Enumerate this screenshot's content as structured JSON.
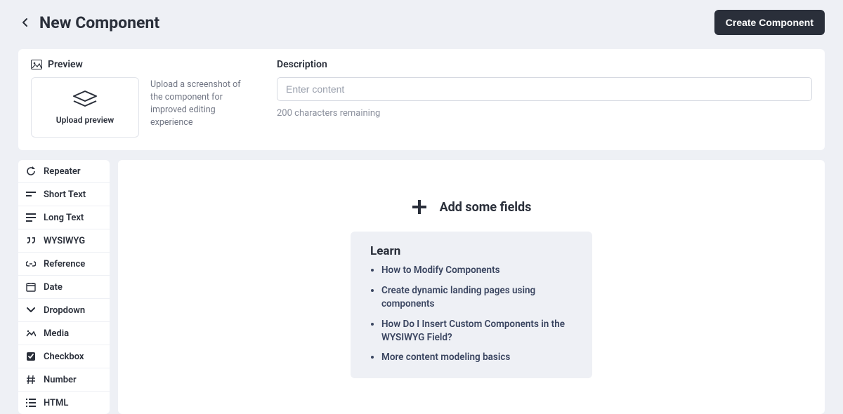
{
  "header": {
    "title": "New Component",
    "create_label": "Create Component"
  },
  "preview": {
    "section_label": "Preview",
    "upload_caption": "Upload preview",
    "help": "Upload a screenshot of the component for improved editing experience"
  },
  "description": {
    "section_label": "Description",
    "placeholder": "Enter content",
    "remaining": "200 characters remaining"
  },
  "fields": [
    {
      "icon": "repeater",
      "label": "Repeater"
    },
    {
      "icon": "short-text",
      "label": "Short Text"
    },
    {
      "icon": "long-text",
      "label": "Long Text"
    },
    {
      "icon": "wysiwyg",
      "label": "WYSIWYG"
    },
    {
      "icon": "reference",
      "label": "Reference"
    },
    {
      "icon": "date",
      "label": "Date"
    },
    {
      "icon": "dropdown",
      "label": "Dropdown"
    },
    {
      "icon": "media",
      "label": "Media"
    },
    {
      "icon": "checkbox",
      "label": "Checkbox"
    },
    {
      "icon": "number",
      "label": "Number"
    },
    {
      "icon": "html",
      "label": "HTML"
    }
  ],
  "main": {
    "add_fields": "Add some fields",
    "learn_title": "Learn",
    "learn_links": [
      "How to Modify Components",
      "Create dynamic landing pages using components",
      "How Do I Insert Custom Components in the WYSIWYG Field?",
      "More content modeling basics"
    ]
  }
}
